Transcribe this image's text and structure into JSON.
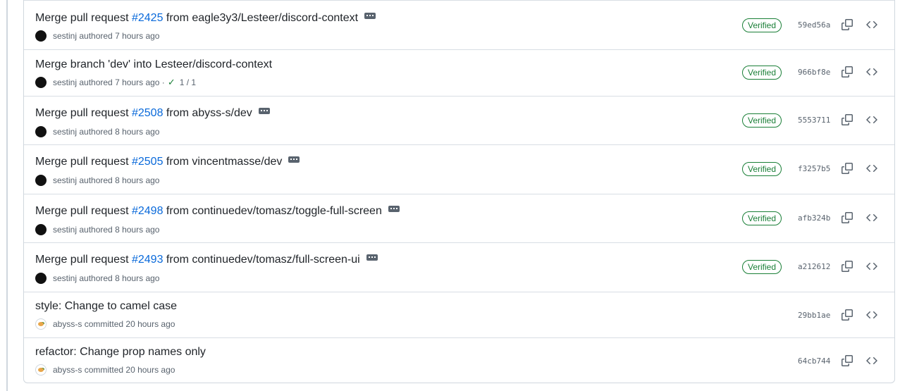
{
  "commits": [
    {
      "title_prefix": "Merge pull request",
      "pr": "#2425",
      "title_suffix": "from eagle3y3/Lesteer/discord-context",
      "author": "sestinj",
      "action": "authored",
      "time": "7 hours ago",
      "status": "",
      "verified": "Verified",
      "sha": "59ed56a",
      "has_ellipsis": true
    },
    {
      "title_prefix": "Merge branch 'dev' into Lesteer/discord-context",
      "pr": "",
      "title_suffix": "",
      "author": "sestinj",
      "action": "authored",
      "time": "7 hours ago",
      "status": "1 / 1",
      "verified": "Verified",
      "sha": "966bf8e",
      "has_ellipsis": false
    },
    {
      "title_prefix": "Merge pull request",
      "pr": "#2508",
      "title_suffix": "from abyss-s/dev",
      "author": "sestinj",
      "action": "authored",
      "time": "8 hours ago",
      "status": "",
      "verified": "Verified",
      "sha": "5553711",
      "has_ellipsis": true
    },
    {
      "title_prefix": "Merge pull request",
      "pr": "#2505",
      "title_suffix": "from vincentmasse/dev",
      "author": "sestinj",
      "action": "authored",
      "time": "8 hours ago",
      "status": "",
      "verified": "Verified",
      "sha": "f3257b5",
      "has_ellipsis": true
    },
    {
      "title_prefix": "Merge pull request",
      "pr": "#2498",
      "title_suffix": "from continuedev/tomasz/toggle-full-screen",
      "author": "sestinj",
      "action": "authored",
      "time": "8 hours ago",
      "status": "",
      "verified": "Verified",
      "sha": "afb324b",
      "has_ellipsis": true
    },
    {
      "title_prefix": "Merge pull request",
      "pr": "#2493",
      "title_suffix": "from continuedev/tomasz/full-screen-ui",
      "author": "sestinj",
      "action": "authored",
      "time": "8 hours ago",
      "status": "",
      "verified": "Verified",
      "sha": "a212612",
      "has_ellipsis": true
    },
    {
      "title_prefix": "style: Change to camel case",
      "pr": "",
      "title_suffix": "",
      "author": "abyss-s",
      "action": "committed",
      "time": "20 hours ago",
      "status": "",
      "verified": "",
      "sha": "29bb1ae",
      "has_ellipsis": false
    },
    {
      "title_prefix": "refactor: Change prop names only",
      "pr": "",
      "title_suffix": "",
      "author": "abyss-s",
      "action": "committed",
      "time": "20 hours ago",
      "status": "",
      "verified": "",
      "sha": "64cb744",
      "has_ellipsis": false
    }
  ],
  "icons": {
    "copy": "copy-icon",
    "browse": "code-browse-icon",
    "ellipsis": "ellipsis-icon",
    "check": "check-icon"
  },
  "colors": {
    "link": "#0969da",
    "verified": "#1a7f37",
    "muted": "#59636e",
    "border": "#d0d7de"
  }
}
